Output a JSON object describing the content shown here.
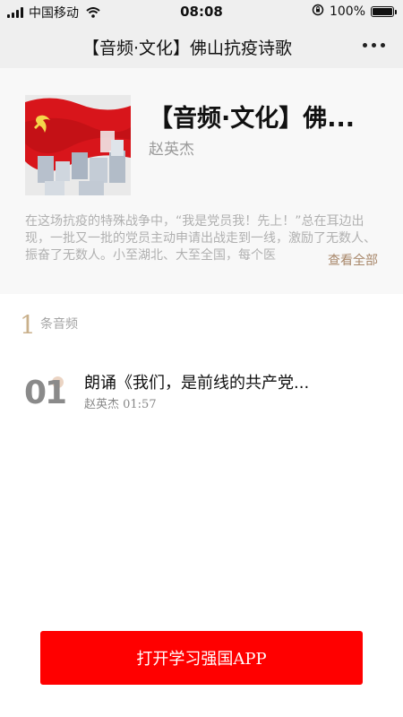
{
  "status_bar": {
    "carrier": "中国移动",
    "time": "08:08",
    "battery": "100%",
    "battery_level": 1.0,
    "icons": [
      "signal-icon",
      "wifi-icon",
      "orientation-lock-icon",
      "battery-icon"
    ]
  },
  "nav": {
    "title": "【音频·文化】佛山抗疫诗歌",
    "more_icon": "more-dots-icon"
  },
  "album": {
    "title": "【音频·文化】佛...",
    "author": "赵英杰",
    "description": "在这场抗疫的特殊战争中，“我是党员我！先上！”总在耳边出现，一批又一批的党员主动申请出战走到一线，激励了无数人、振奋了无数人。小至湖北、大至全国，每个医",
    "view_all": "查看全部"
  },
  "tracks_summary": {
    "count": "1",
    "label": "条音频"
  },
  "tracks": [
    {
      "index": "01",
      "title": "朗诵《我们，是前线的共产党...",
      "meta": "赵英杰 01:57"
    }
  ],
  "footer": {
    "button_label": "打开学习强国APP"
  },
  "colors": {
    "accent_red": "#ff0000",
    "gold": "#c9b08b",
    "view_all": "#a8876a",
    "nav_bg": "#efefef"
  }
}
